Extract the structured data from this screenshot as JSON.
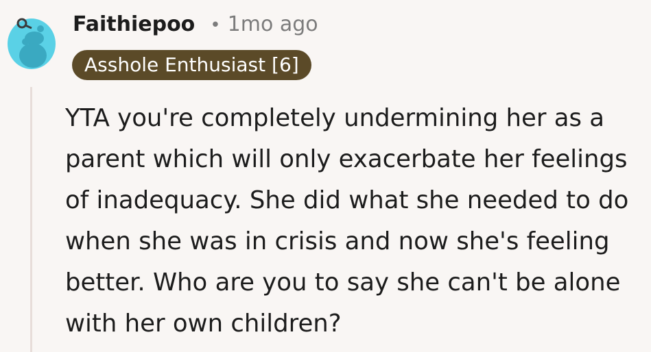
{
  "comment": {
    "username": "Faithiepoo",
    "separator": "•",
    "timestamp": "1mo ago",
    "flair": "Asshole Enthusiast [6]",
    "body": "YTA you're completely undermining her as a parent which will only exacerbate her feelings of inadequacy. She did what she needed to do when she was in crisis and now she's feeling better. Who are you to say she can't be alone with her own children?",
    "avatar": {
      "icon": "snoo-avatar-icon",
      "colors": {
        "background": "#5ad1e6",
        "dark": "#3aa9c1",
        "flair_bg": "#5b4a28"
      }
    }
  }
}
